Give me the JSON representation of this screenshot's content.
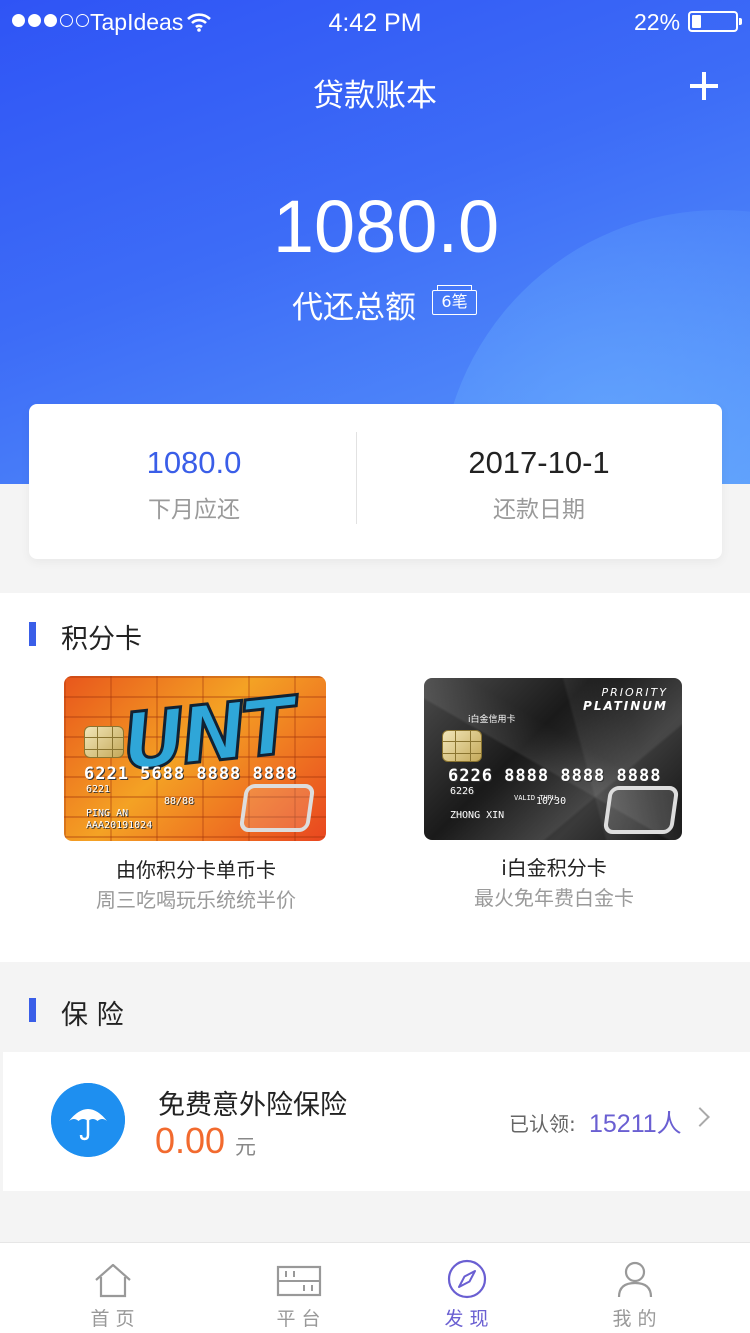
{
  "status_bar": {
    "carrier": "TapIdeas",
    "time": "4:42 PM",
    "battery": "22%"
  },
  "header": {
    "title": "贷款账本"
  },
  "summary": {
    "total_amount": "1080.0",
    "total_label": "代还总额",
    "count_badge": "6笔",
    "next_month_amount": "1080.0",
    "next_month_label": "下月应还",
    "repay_date": "2017-10-1",
    "repay_date_label": "还款日期"
  },
  "points_cards": {
    "title": "积分卡",
    "items": [
      {
        "name": "由你积分卡单币卡",
        "desc": "周三吃喝玩乐统统半价",
        "art": {
          "logo": "UNT",
          "number": "6221 5688 8888 8888",
          "small_lines": [
            "6221",
            "88/88",
            "PING AN",
            "AAA20191024"
          ]
        }
      },
      {
        "name": "i白金积分卡",
        "desc": "最火免年费白金卡",
        "art": {
          "brand_line1": "PRIORITY",
          "brand_line2": "PLATINUM",
          "bank": "i白金信用卡",
          "number": "6226 8888 8888 8888",
          "small_lines": [
            "6226",
            "VALID THRU",
            "10/30",
            "ZHONG XIN"
          ]
        }
      }
    ]
  },
  "insurance": {
    "title": "保 险",
    "item": {
      "name": "免费意外险保险",
      "price": "0.00",
      "unit": "元",
      "claimed_label": "已认领:",
      "claimed_value": "15211人"
    }
  },
  "tab_bar": {
    "tabs": [
      {
        "label": "首页",
        "icon": "home-icon",
        "active": false
      },
      {
        "label": "平台",
        "icon": "abacus-icon",
        "active": false
      },
      {
        "label": "发现",
        "icon": "compass-icon",
        "active": true
      },
      {
        "label": "我的",
        "icon": "user-icon",
        "active": false
      }
    ]
  },
  "colors": {
    "accent": "#3a5ee8",
    "price": "#f26a2e",
    "active_tab": "#6a5fd2"
  }
}
